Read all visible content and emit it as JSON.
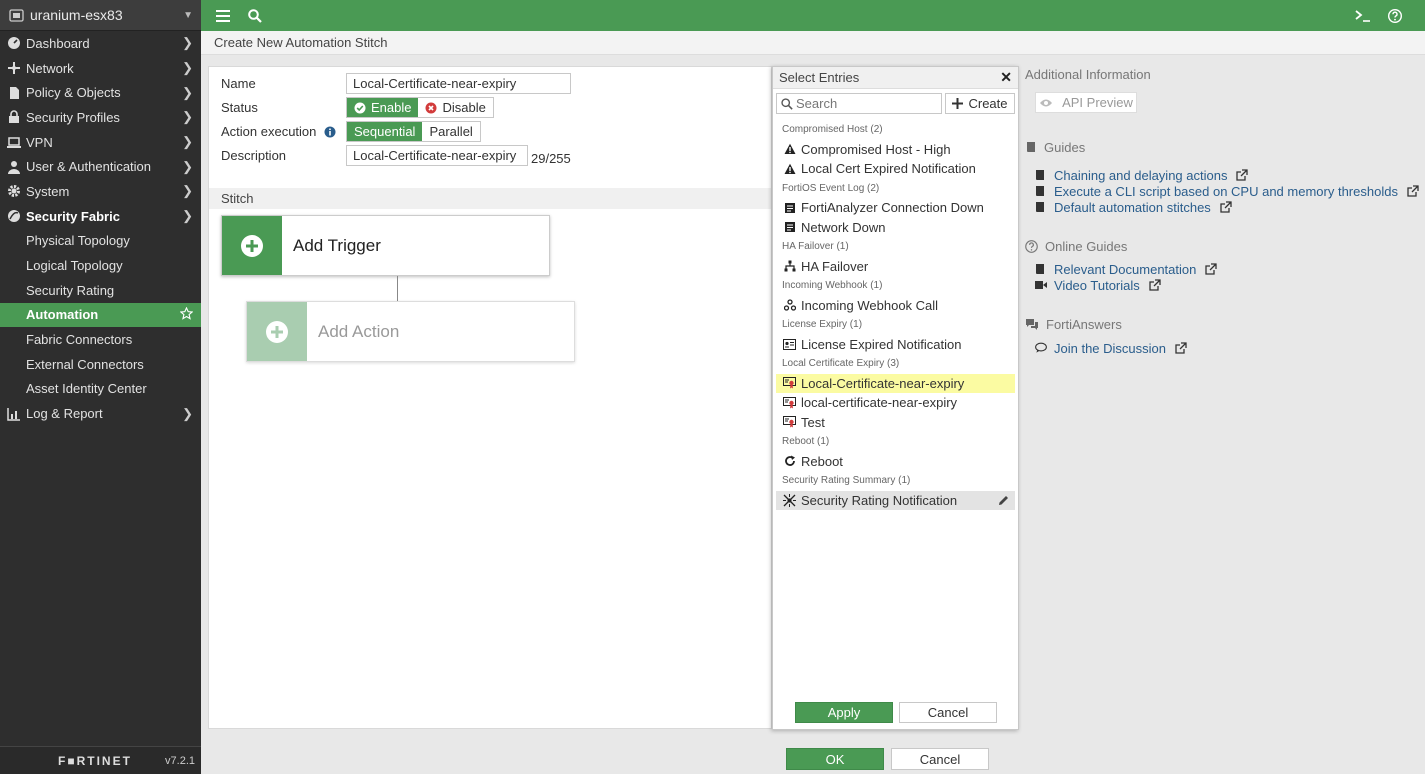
{
  "colors": {
    "accent": "#4a9a54",
    "sidebar_bg": "#2e2e2e",
    "highlight": "#fbfba2",
    "link": "#2a5d8c"
  },
  "device": {
    "name": "uranium-esx83"
  },
  "sidebar": {
    "items": [
      {
        "label": "Dashboard",
        "icon": "dashboard-icon"
      },
      {
        "label": "Network",
        "icon": "network-icon"
      },
      {
        "label": "Policy & Objects",
        "icon": "policy-icon"
      },
      {
        "label": "Security Profiles",
        "icon": "lock-icon"
      },
      {
        "label": "VPN",
        "icon": "laptop-icon"
      },
      {
        "label": "User & Authentication",
        "icon": "user-icon"
      },
      {
        "label": "System",
        "icon": "gear-icon"
      },
      {
        "label": "Security Fabric",
        "icon": "fabric-icon"
      }
    ],
    "sub_items": [
      {
        "label": "Physical Topology"
      },
      {
        "label": "Logical Topology"
      },
      {
        "label": "Security Rating"
      },
      {
        "label": "Automation"
      },
      {
        "label": "Fabric Connectors"
      },
      {
        "label": "External Connectors"
      },
      {
        "label": "Asset Identity Center"
      }
    ],
    "last_item": {
      "label": "Log & Report",
      "icon": "chart-icon"
    },
    "logo": "F■RTINET",
    "version": "v7.2.1"
  },
  "page": {
    "title": "Create New Automation Stitch"
  },
  "form": {
    "name_label": "Name",
    "name_value": "Local-Certificate-near-expiry",
    "status_label": "Status",
    "status_enable": "Enable",
    "status_disable": "Disable",
    "action_execution_label": "Action execution",
    "exec_sequential": "Sequential",
    "exec_parallel": "Parallel",
    "description_label": "Description",
    "description_value": "Local-Certificate-near-expiry",
    "description_counter": "29/255",
    "stitch_label": "Stitch",
    "add_trigger": "Add Trigger",
    "add_action": "Add Action"
  },
  "select_entries": {
    "title": "Select Entries",
    "search_placeholder": "Search",
    "create_label": "Create",
    "groups": [
      {
        "label": "Compromised Host (2)",
        "entries": [
          {
            "label": "Compromised Host - High",
            "icon": "warning-icon"
          },
          {
            "label": "Local Cert Expired Notification",
            "icon": "warning-icon"
          }
        ]
      },
      {
        "label": "FortiOS Event Log (2)",
        "entries": [
          {
            "label": "FortiAnalyzer Connection Down",
            "icon": "log-icon"
          },
          {
            "label": "Network Down",
            "icon": "log-icon"
          }
        ]
      },
      {
        "label": "HA Failover (1)",
        "entries": [
          {
            "label": "HA Failover",
            "icon": "sitemap-icon"
          }
        ]
      },
      {
        "label": "Incoming Webhook (1)",
        "entries": [
          {
            "label": "Incoming Webhook Call",
            "icon": "webhook-icon"
          }
        ]
      },
      {
        "label": "License Expiry (1)",
        "entries": [
          {
            "label": "License Expired Notification",
            "icon": "license-icon"
          }
        ]
      },
      {
        "label": "Local Certificate Expiry (3)",
        "entries": [
          {
            "label": "Local-Certificate-near-expiry",
            "icon": "certificate-icon"
          },
          {
            "label": "local-certificate-near-expiry",
            "icon": "certificate-icon"
          },
          {
            "label": "Test",
            "icon": "certificate-icon"
          }
        ]
      },
      {
        "label": "Reboot (1)",
        "entries": [
          {
            "label": "Reboot",
            "icon": "reboot-icon"
          }
        ]
      },
      {
        "label": "Security Rating Summary (1)",
        "entries": [
          {
            "label": "Security Rating Notification",
            "icon": "rating-icon"
          }
        ]
      }
    ],
    "apply_label": "Apply",
    "cancel_label": "Cancel"
  },
  "additional_info": {
    "title": "Additional Information",
    "api_preview": "API Preview",
    "guides_title": "Guides",
    "guides": [
      "Chaining and delaying actions",
      "Execute a CLI script based on CPU and memory thresholds",
      "Default automation stitches"
    ],
    "online_guides_title": "Online Guides",
    "online_guides": [
      {
        "label": "Relevant Documentation",
        "icon": "book-icon"
      },
      {
        "label": "Video Tutorials",
        "icon": "video-icon"
      }
    ],
    "fortianswers_title": "FortiAnswers",
    "join_discussion": "Join the Discussion"
  },
  "footer": {
    "ok_label": "OK",
    "cancel_label": "Cancel"
  }
}
